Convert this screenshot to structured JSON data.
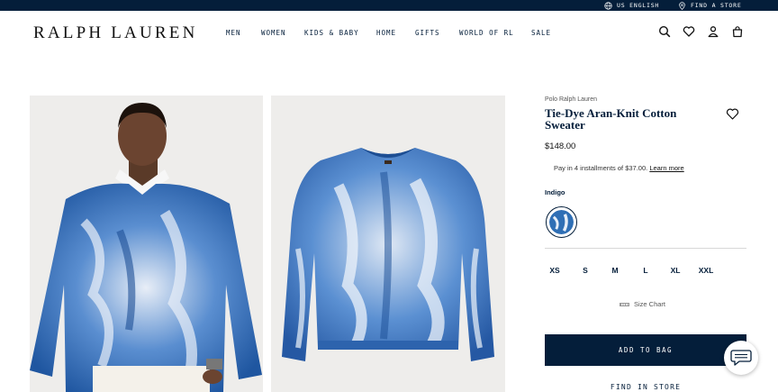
{
  "utility_bar": {
    "language": "US ENGLISH",
    "find_store": "FIND A STORE"
  },
  "header": {
    "logo": "RALPH LAUREN",
    "nav": [
      "MEN",
      "WOMEN",
      "KIDS & BABY",
      "HOME",
      "GIFTS",
      "WORLD OF RL",
      "SALE"
    ],
    "icons": [
      "search-icon",
      "heart-icon",
      "account-icon",
      "bag-icon"
    ]
  },
  "product": {
    "brand": "Polo Ralph Lauren",
    "title": "Tie-Dye Aran-Knit Cotton Sweater",
    "price": "$148.00",
    "installments_text": "Pay in 4 installments of $37.00.",
    "learn_more": "Learn more",
    "color_label": "Indigo",
    "sizes": [
      "XS",
      "S",
      "M",
      "L",
      "XL",
      "XXL"
    ],
    "size_chart": "Size Chart",
    "add_to_bag": "ADD TO BAG",
    "find_in_store": "FIND IN STORE"
  },
  "colors": {
    "navy": "#041e3a",
    "indigo": "#2f6fb5",
    "image_bg": "#eeedeb"
  }
}
